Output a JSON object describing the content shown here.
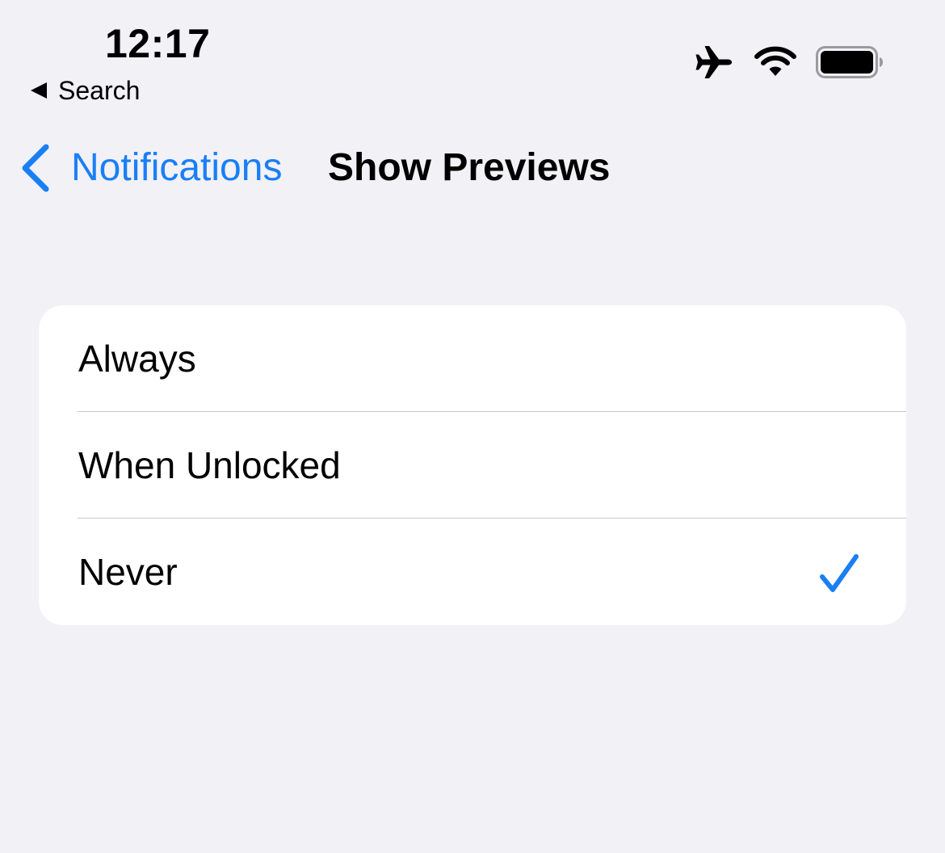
{
  "status_bar": {
    "time": "12:17",
    "back_app_label": "Search",
    "icons": [
      "airplane-icon",
      "wifi-icon",
      "battery-icon"
    ]
  },
  "nav": {
    "back_label": "Notifications",
    "title": "Show Previews"
  },
  "options": [
    {
      "label": "Always",
      "selected": false
    },
    {
      "label": "When Unlocked",
      "selected": false
    },
    {
      "label": "Never",
      "selected": true
    }
  ],
  "colors": {
    "accent": "#1a7ff5",
    "background": "#f1f1f6",
    "card": "#ffffff",
    "separator": "#c9c9ce"
  }
}
